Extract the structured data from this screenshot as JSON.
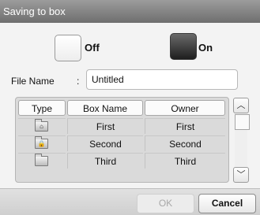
{
  "dialog": {
    "title": "Saving to box"
  },
  "toggle": {
    "off_label": "Off",
    "on_label": "On",
    "selected": "On"
  },
  "file": {
    "label": "File Name",
    "separator": ":",
    "value": "Untitled"
  },
  "table": {
    "headers": [
      "Type",
      "Box Name",
      "Owner"
    ],
    "rows": [
      {
        "icon": "home-folder-icon",
        "icon_glyph": "⌂",
        "name": "First",
        "owner": "First"
      },
      {
        "icon": "locked-folder-icon",
        "icon_glyph": "🔒",
        "name": "Second",
        "owner": "Second"
      },
      {
        "icon": "folder-icon",
        "icon_glyph": "",
        "name": "Third",
        "owner": "Third"
      }
    ]
  },
  "scrollbar": {
    "up_glyph": "︿",
    "down_glyph": "﹀",
    "up_icon": "chevron-up-icon",
    "down_icon": "chevron-down-icon"
  },
  "buttons": {
    "ok": "OK",
    "cancel": "Cancel"
  }
}
